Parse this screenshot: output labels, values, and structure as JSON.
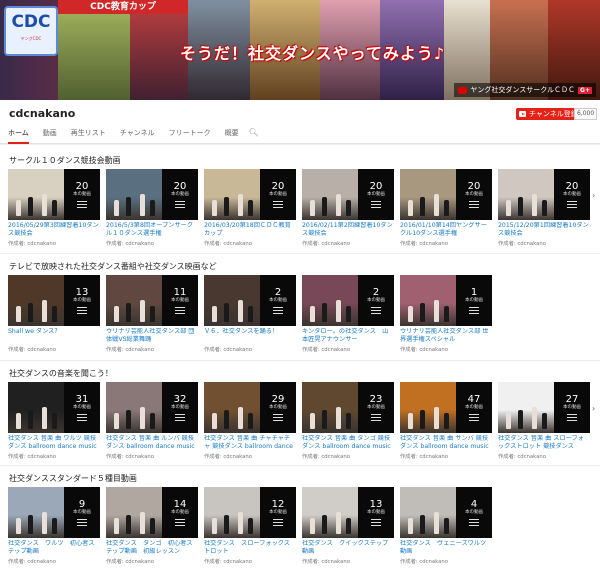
{
  "banner": {
    "logo_text": "CDC",
    "logo_sub": "ヤングCDC",
    "strip_text": "CDC教育カップ",
    "slogan": "そうだ！社交ダンスやってみよう♪",
    "channel_label": "ヤング社交ダンスサークルＣＤＣ",
    "gplus": "G+"
  },
  "channel": {
    "name": "cdcnakano",
    "subscribe_label": "チャンネル登録",
    "subscriber_count": "6,000",
    "tabs": [
      "ホーム",
      "動画",
      "再生リスト",
      "チャンネル",
      "フリートーク",
      "概要"
    ],
    "search_icon": "search-icon"
  },
  "playlist_count_label": "本の動画",
  "sections": [
    {
      "title": "サークル１０ダンス競技会動画",
      "cards": [
        {
          "count": "20",
          "title": "2016/05/29第3回練習着10ダンス競技会",
          "by": "作成者: cdcnakano",
          "tone": "#d8d0c0"
        },
        {
          "count": "20",
          "title": "2016/5/3第8回オープンサークル１０ダンス選手権",
          "by": "作成者: cdcnakano",
          "tone": "#5a7080"
        },
        {
          "count": "20",
          "title": "2016/03/20第18回ＣＤＣ教育カップ",
          "by": "作成者: cdcnakano",
          "tone": "#c8b898"
        },
        {
          "count": "20",
          "title": "2016/02/11第2回練習着10ダンス競技会",
          "by": "作成者: cdcnakano",
          "tone": "#b8b0a8"
        },
        {
          "count": "20",
          "title": "2016/01/10第14回ヤングサークル10ダンス選手権",
          "by": "作成者: cdcnakano",
          "tone": "#a89880"
        },
        {
          "count": "20",
          "title": "2015/12/20第1回練習着10ダンス競技会",
          "by": "作成者: cdcnakano",
          "tone": "#d0c8c0"
        }
      ]
    },
    {
      "title": "テレビで放映された社交ダンス番組や社交ダンス映画など",
      "cards": [
        {
          "count": "13",
          "title": "Shall we ダンス？",
          "by": "作成者: cdcnakano",
          "tone": "#503828"
        },
        {
          "count": "11",
          "title": "ウリナリ芸能人社交ダンス部 団体戦VS総業舞踊",
          "by": "作成者: cdcnakano",
          "tone": "#604840"
        },
        {
          "count": "2",
          "title": "Ｖ６．社交ダンスを踊る！",
          "by": "作成者: cdcnakano",
          "tone": "#483830"
        },
        {
          "count": "2",
          "title": "キンタロー。の社交ダンス　山本匠晃アナウンサー",
          "by": "作成者: cdcnakano",
          "tone": "#784858"
        },
        {
          "count": "1",
          "title": "ウリナリ芸能人社交ダンス部 世界選手権スペシャル",
          "by": "作成者: cdcnakano",
          "tone": "#a06070"
        }
      ]
    },
    {
      "title": "社交ダンスの音楽を聞こう！",
      "cards": [
        {
          "count": "31",
          "title": "社交ダンス 音楽 曲 ワルツ 競技ダンス ballroom dance music walt...",
          "by": "作成者: cdcnakano",
          "tone": "#202020"
        },
        {
          "count": "32",
          "title": "社交ダンス 音楽 曲 ルンバ 競技ダンス ballroom dance music",
          "by": "作成者: cdcnakano",
          "tone": "#8a7878"
        },
        {
          "count": "29",
          "title": "社交ダンス 音楽 曲 チャチャチャ 競技ダンス ballroom dance",
          "by": "作成者: cdcnakano",
          "tone": "#705030"
        },
        {
          "count": "23",
          "title": "社交ダンス 音楽 曲 タンゴ 競技ダンス ballroom dance music tang...",
          "by": "作成者: cdcnakano",
          "tone": "#604830"
        },
        {
          "count": "47",
          "title": "社交ダンス 音楽 曲 サンバ 競技ダンス ballroom dance music",
          "by": "作成者: cdcnakano",
          "tone": "#c07020"
        },
        {
          "count": "27",
          "title": "社交ダンス 音楽 曲 スローフォックストロット 競技ダンス",
          "by": "作成者: cdcnakano",
          "tone": "#f0f0f0"
        }
      ]
    },
    {
      "title": "社交ダンススタンダード５種目動画",
      "cards": [
        {
          "count": "9",
          "title": "社交ダンス　ワルツ　初心者ステップ動画",
          "by": "作成者: cdcnakano",
          "tone": "#9aa8b8"
        },
        {
          "count": "14",
          "title": "社交ダンス　タンゴ　初心者ステップ動画　初級レッスン",
          "by": "作成者: cdcnakano",
          "tone": "#b0a8a0"
        },
        {
          "count": "12",
          "title": "社交ダンス　スローフォックストロット",
          "by": "作成者: cdcnakano",
          "tone": "#c8c4c0"
        },
        {
          "count": "13",
          "title": "社交ダンス　クイックステップ動画",
          "by": "作成者: cdcnakano",
          "tone": "#d0ccc8"
        },
        {
          "count": "4",
          "title": "社交ダンス　ヴェニーズワルツ動画",
          "by": "作成者: cdcnakano",
          "tone": "#c0bcb8"
        }
      ]
    }
  ]
}
